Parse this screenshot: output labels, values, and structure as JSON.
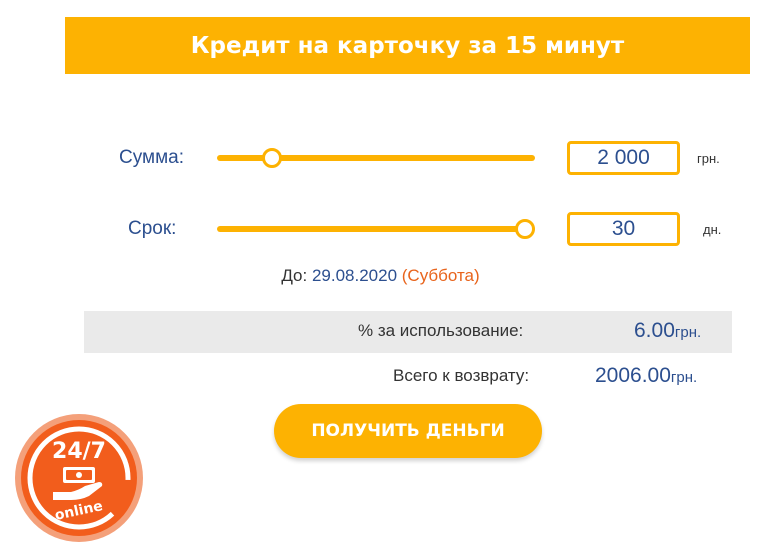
{
  "header": {
    "title": "Кредит на карточку за 15 минут"
  },
  "amount": {
    "label": "Сумма:",
    "value": "2 000",
    "unit": "грн.",
    "slider_fraction": 0.15
  },
  "term": {
    "label": "Срок:",
    "value": "30",
    "unit": "дн.",
    "slider_fraction": 1.0
  },
  "due": {
    "prefix": "До:",
    "date": "29.08.2020",
    "day": "(Суббота)"
  },
  "summary": {
    "fee_label": "% за использование:",
    "fee_value": "6.00",
    "fee_unit": "грн.",
    "total_label": "Всего к возврату:",
    "total_value": "2006.00",
    "total_unit": "грн."
  },
  "cta": {
    "label": "ПОЛУЧИТЬ ДЕНЬГИ"
  },
  "badge": {
    "line1": "24/7",
    "line2": "online"
  },
  "colors": {
    "accent": "#fdb202",
    "text_blue": "#2c4f8f",
    "day_orange": "#e8641c",
    "badge_red": "#f25d1c"
  }
}
